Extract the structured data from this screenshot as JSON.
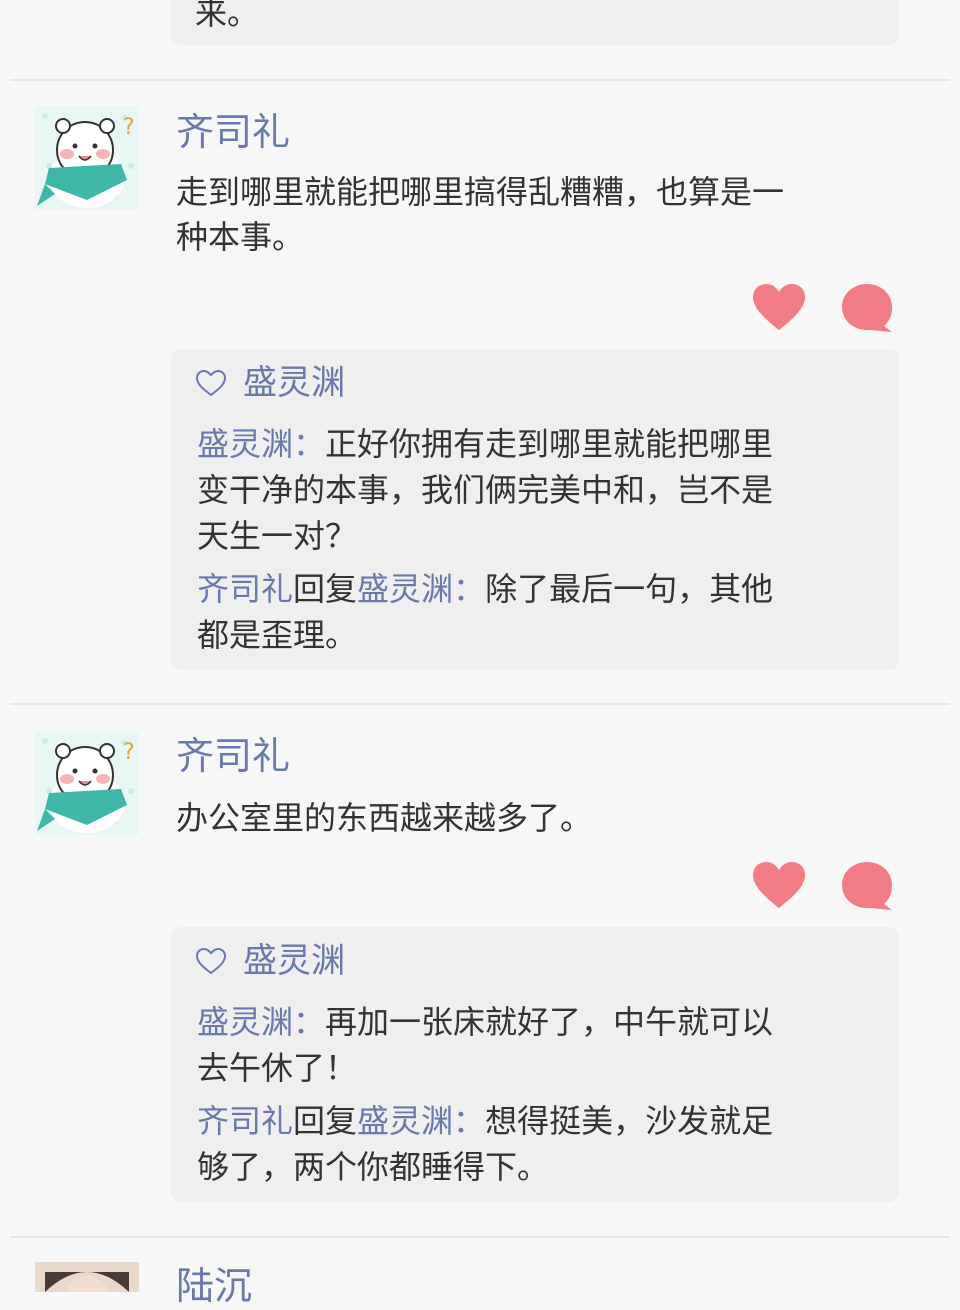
{
  "previous_reply": {
    "tail": "来。"
  },
  "comments": [
    {
      "author": "齐司礼",
      "text": "走到哪里就能把哪里搞得乱糟糟，也算是一种本事。",
      "text_lines": [
        "走到哪里就能把哪里搞得乱糟糟，也算是一",
        "种本事。"
      ],
      "likes": [
        "盛灵渊"
      ],
      "replies": [
        {
          "from": "盛灵渊",
          "to": null,
          "reply_word": null,
          "sep": "：",
          "lines": [
            "正好你拥有走到哪里就能把哪里",
            "变干净的本事，我们俩完美中和，岂不是",
            "天生一对？"
          ]
        },
        {
          "from": "齐司礼",
          "to": "盛灵渊",
          "reply_word": "回复",
          "sep": "：",
          "lines": [
            "除了最后一句，其他",
            "都是歪理。"
          ]
        }
      ]
    },
    {
      "author": "齐司礼",
      "text": "办公室里的东西越来越多了。",
      "text_lines": [
        "办公室里的东西越来越多了。"
      ],
      "likes": [
        "盛灵渊"
      ],
      "replies": [
        {
          "from": "盛灵渊",
          "to": null,
          "reply_word": null,
          "sep": "：",
          "lines": [
            "再加一张床就好了，中午就可以",
            "去午休了！"
          ]
        },
        {
          "from": "齐司礼",
          "to": "盛灵渊",
          "reply_word": "回复",
          "sep": "：",
          "lines": [
            "想得挺美，沙发就足",
            "够了，两个你都睡得下。"
          ]
        }
      ]
    }
  ],
  "next_comment": {
    "author": "陆沉"
  },
  "icons": {
    "avatar": "white-bear-teal-scarf-avatar",
    "like": "heart-icon",
    "comment": "speech-bubble-icon",
    "small_like": "heart-outline-icon"
  },
  "colors": {
    "name": "#6a79ad",
    "accent_pink": "#f17c86",
    "box": "#efefef"
  }
}
